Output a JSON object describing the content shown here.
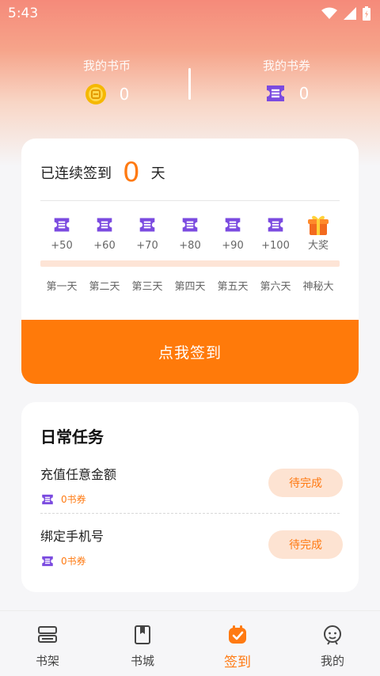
{
  "status": {
    "time": "5:43"
  },
  "wallet": {
    "coins_label": "我的书币",
    "coins_value": "0",
    "tickets_label": "我的书券",
    "tickets_value": "0"
  },
  "signin": {
    "streak_prefix": "已连续签到",
    "streak_days": "0",
    "streak_suffix": "天",
    "rewards": [
      {
        "amount": "+50",
        "day": "第一天",
        "icon": "ticket-icon"
      },
      {
        "amount": "+60",
        "day": "第二天",
        "icon": "ticket-icon"
      },
      {
        "amount": "+70",
        "day": "第三天",
        "icon": "ticket-icon"
      },
      {
        "amount": "+80",
        "day": "第四天",
        "icon": "ticket-icon"
      },
      {
        "amount": "+90",
        "day": "第五天",
        "icon": "ticket-icon"
      },
      {
        "amount": "+100",
        "day": "第六天",
        "icon": "ticket-icon"
      },
      {
        "amount": "大奖",
        "day": "神秘大",
        "icon": "gift-icon"
      }
    ],
    "button_label": "点我签到"
  },
  "tasks": {
    "title": "日常任务",
    "items": [
      {
        "name": "充值任意金额",
        "reward": "0书券",
        "action": "待完成"
      },
      {
        "name": "绑定手机号",
        "reward": "0书券",
        "action": "待完成"
      }
    ]
  },
  "tabbar": {
    "items": [
      {
        "label": "书架",
        "icon": "bookshelf-icon"
      },
      {
        "label": "书城",
        "icon": "book-icon"
      },
      {
        "label": "签到",
        "icon": "checkin-icon"
      },
      {
        "label": "我的",
        "icon": "profile-icon"
      }
    ],
    "active": "签到"
  },
  "colors": {
    "accent": "#ff7a0a",
    "ticket": "#7b4be0",
    "coin": "#f5b800"
  }
}
